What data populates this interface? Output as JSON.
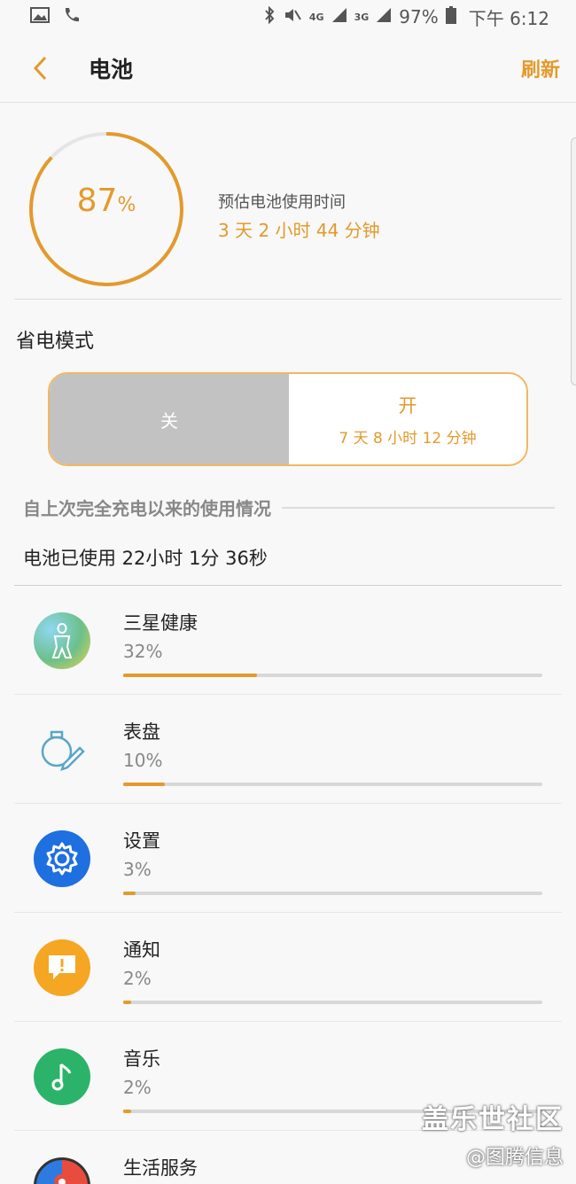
{
  "status_bar": {
    "battery": "97%",
    "time": "下午 6:12",
    "network_1": "4G",
    "network_2": "3G"
  },
  "header": {
    "title": "电池",
    "refresh_label": "刷新"
  },
  "battery": {
    "level_value": "87",
    "level_unit": "%",
    "level_fraction": 0.87,
    "estimate_label": "预估电池使用时间",
    "estimate_value": "3 天 2 小时 44 分钟"
  },
  "power_saving": {
    "title": "省电模式",
    "off_label": "关",
    "on_label": "开",
    "on_estimate": "7 天 8 小时 12 分钟"
  },
  "usage": {
    "section_title": "自上次完全充电以来的使用情况",
    "used_time": "电池已使用 22小时 1分 36秒",
    "apps": [
      {
        "name": "三星健康",
        "percent": "32%",
        "fraction": 0.32,
        "icon": "samsung-health-icon"
      },
      {
        "name": "表盘",
        "percent": "10%",
        "fraction": 0.1,
        "icon": "watch-face-icon"
      },
      {
        "name": "设置",
        "percent": "3%",
        "fraction": 0.03,
        "icon": "settings-gear-icon"
      },
      {
        "name": "通知",
        "percent": "2%",
        "fraction": 0.02,
        "icon": "notification-icon"
      },
      {
        "name": "音乐",
        "percent": "2%",
        "fraction": 0.02,
        "icon": "music-icon"
      },
      {
        "name": "生活服务",
        "percent": "",
        "fraction": null,
        "icon": "life-service-icon"
      }
    ]
  },
  "watermark": {
    "line1": "盖乐世社区",
    "line2": "@图腾信息"
  },
  "colors": {
    "accent": "#e39a2c",
    "toggle_off": "#c2c2c2",
    "track": "#d8d8d8"
  }
}
